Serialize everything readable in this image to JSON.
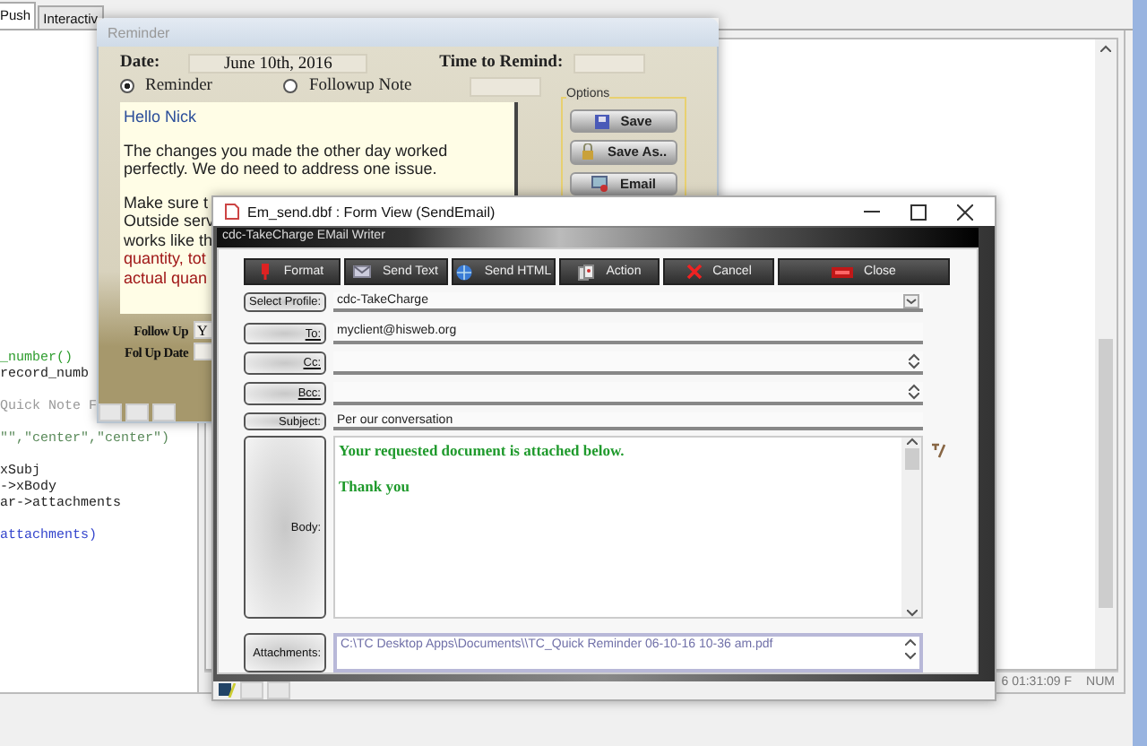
{
  "background_app": {
    "tabs": [
      {
        "label": "Push",
        "selected": true
      },
      {
        "label": "Interactiv",
        "selected": false
      }
    ],
    "code_blocks": [
      [
        {
          "kind": "function",
          "text": "_number()"
        },
        {
          "kind": "plain",
          "text": "record_numb"
        }
      ],
      [
        {
          "kind": "comment",
          "text": "Quick Note F"
        }
      ],
      [
        {
          "kind": "string",
          "text": "\"\",\"center\",\"center\")"
        }
      ],
      [
        {
          "kind": "plain",
          "text": "xSubj"
        },
        {
          "kind": "plain",
          "text": "->xBody"
        },
        {
          "kind": "plain",
          "text": "ar->attachments"
        }
      ],
      [
        {
          "kind": "keyword",
          "text": "attachments)"
        }
      ]
    ],
    "status_bar": [
      "6 01:31:09 F",
      "NUM"
    ]
  },
  "reminder": {
    "title": "Reminder",
    "date_label": "Date:",
    "date": "June 10th, 2016",
    "time_label": "Time to Remind:",
    "modes": [
      {
        "label": "Reminder",
        "selected": true
      },
      {
        "label": "Followup Note",
        "selected": false
      }
    ],
    "note": [
      [
        {
          "kind": "greeting",
          "text": "Hello Nick"
        }
      ],
      [
        {
          "kind": "text",
          "text": "The changes you made the other day worked"
        },
        {
          "kind": "text",
          "text": "perfectly. We do need to address one issue."
        }
      ],
      [
        {
          "kind": "text",
          "text": "Make sure t"
        },
        {
          "kind": "text",
          "text": "Outside serv"
        },
        {
          "kind": "text",
          "text": "works like th"
        },
        {
          "kind": "alert",
          "text": "quantity, tot"
        },
        {
          "kind": "alert",
          "text": "actual quan"
        }
      ]
    ],
    "options": {
      "title": "Options",
      "buttons": [
        "Save",
        "Save As..",
        "Email"
      ]
    },
    "follow_up": {
      "label": "Follow Up",
      "value": "Y"
    },
    "follow_up_date": {
      "label": "Fol Up Date"
    }
  },
  "email": {
    "window_title": "Em_send.dbf : Form View (SendEmail)",
    "header": "cdc-TakeCharge EMail Writer",
    "toolbar": [
      "Format",
      "Send Text",
      "Send HTML",
      "Action",
      "Cancel",
      "Close"
    ],
    "fields": [
      {
        "kind": "select",
        "label": "Select Profile:",
        "value": "cdc-TakeCharge"
      },
      {
        "kind": "address",
        "label": "To:",
        "value": "myclient@hisweb.org"
      },
      {
        "kind": "multi",
        "label": "Cc:"
      },
      {
        "kind": "multi",
        "label": "Bcc:"
      },
      {
        "kind": "text",
        "label": "Subject:",
        "value": "Per our conversation"
      }
    ],
    "body": {
      "label": "Body:",
      "lines": [
        "Your requested document is attached below.",
        "Thank you"
      ]
    },
    "attachments": {
      "label": "Attachments:",
      "value": "C:\\TC Desktop Apps\\Documents\\\\TC_Quick Reminder 06-10-16 10-36 am.pdf"
    }
  }
}
